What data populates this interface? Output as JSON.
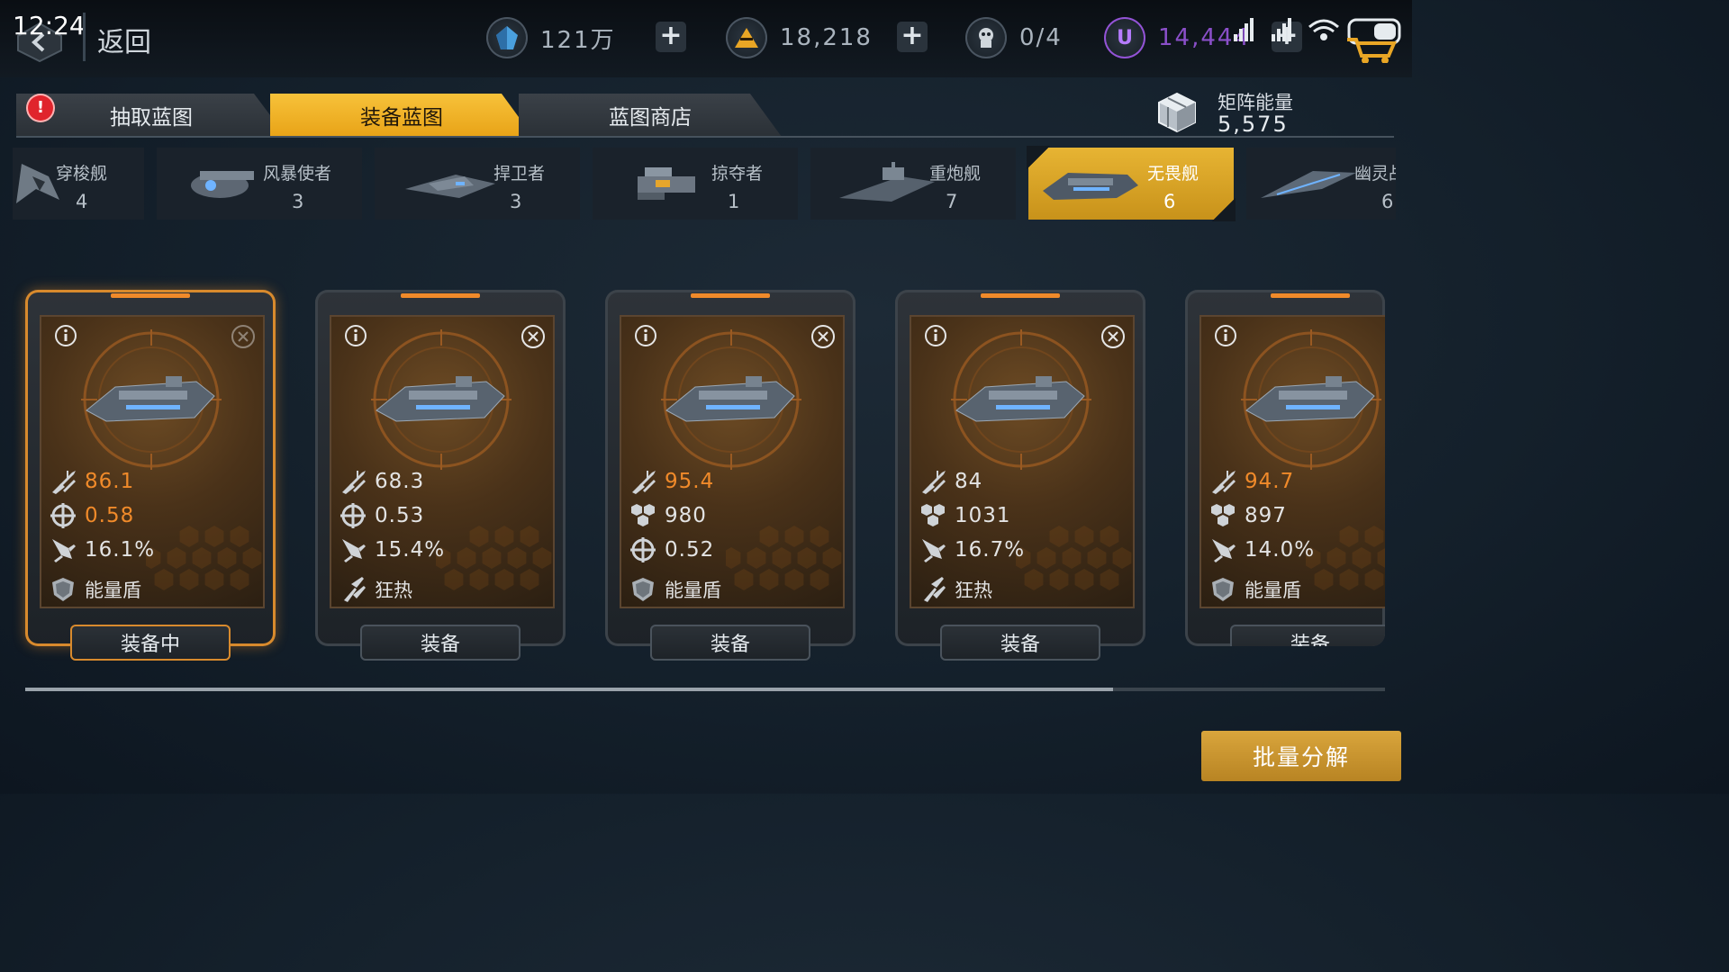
{
  "status_bar": {
    "time": "12:24"
  },
  "top_bar": {
    "back_label": "返回",
    "resources": [
      {
        "icon": "crystal-icon",
        "value": "121万",
        "has_plus": true
      },
      {
        "icon": "gold-icon",
        "value": "18,218",
        "has_plus": true
      },
      {
        "icon": "pilot-icon",
        "value": "0/4",
        "has_plus": false
      },
      {
        "icon": "u-currency-icon",
        "value": "14,444",
        "has_plus": true
      }
    ]
  },
  "tabs": [
    {
      "label": "抽取蓝图",
      "active": false,
      "alert": "!"
    },
    {
      "label": "装备蓝图",
      "active": true
    },
    {
      "label": "蓝图商店",
      "active": false
    }
  ],
  "matrix_energy": {
    "label": "矩阵能量",
    "value": "5,575"
  },
  "ship_classes": [
    {
      "name": "穿梭舰",
      "count": "4"
    },
    {
      "name": "风暴使者",
      "count": "3"
    },
    {
      "name": "捍卫者",
      "count": "3"
    },
    {
      "name": "掠夺者",
      "count": "1"
    },
    {
      "name": "重炮舰",
      "count": "7"
    },
    {
      "name": "无畏舰",
      "count": "6",
      "selected": true
    },
    {
      "name": "幽灵战",
      "count": "6"
    }
  ],
  "cards": [
    {
      "attack": "86.1",
      "stat2_icon": "crosshair-icon",
      "stat2": "0.58",
      "stat3_icon": "missile-icon",
      "stat3": "16.1%",
      "skill_icon": "shield-icon",
      "skill": "能量盾",
      "button": "装备中",
      "equipped": true,
      "highlight": [
        true,
        true,
        false
      ]
    },
    {
      "attack": "68.3",
      "stat2_icon": "crosshair-icon",
      "stat2": "0.53",
      "stat3_icon": "missile-icon",
      "stat3": "15.4%",
      "skill_icon": "frenzy-icon",
      "skill": "狂热",
      "button": "装备",
      "equipped": false,
      "highlight": [
        false,
        false,
        false
      ]
    },
    {
      "attack": "95.4",
      "stat2_icon": "hp-icon",
      "stat2": "980",
      "stat3_icon": "crosshair-icon",
      "stat3": "0.52",
      "skill_icon": "shield-icon",
      "skill": "能量盾",
      "button": "装备",
      "equipped": false,
      "highlight": [
        true,
        false,
        false
      ]
    },
    {
      "attack": "84",
      "stat2_icon": "hp-icon",
      "stat2": "1031",
      "stat3_icon": "missile-icon",
      "stat3": "16.7%",
      "skill_icon": "frenzy-icon",
      "skill": "狂热",
      "button": "装备",
      "equipped": false,
      "highlight": [
        false,
        false,
        false
      ]
    },
    {
      "attack": "94.7",
      "stat2_icon": "hp-icon",
      "stat2": "897",
      "stat3_icon": "missile-icon",
      "stat3": "14.0%",
      "skill_icon": "shield-icon",
      "skill": "能量盾",
      "button": "装备",
      "equipped": false,
      "highlight": [
        true,
        false,
        false
      ]
    }
  ],
  "scroll": {
    "position_fraction": 0.8
  },
  "bulk_button": {
    "label": "批量分解"
  },
  "colors": {
    "accent": "#f0b22a",
    "stat_highlight": "#f08a2a",
    "alert": "#e0242c"
  }
}
